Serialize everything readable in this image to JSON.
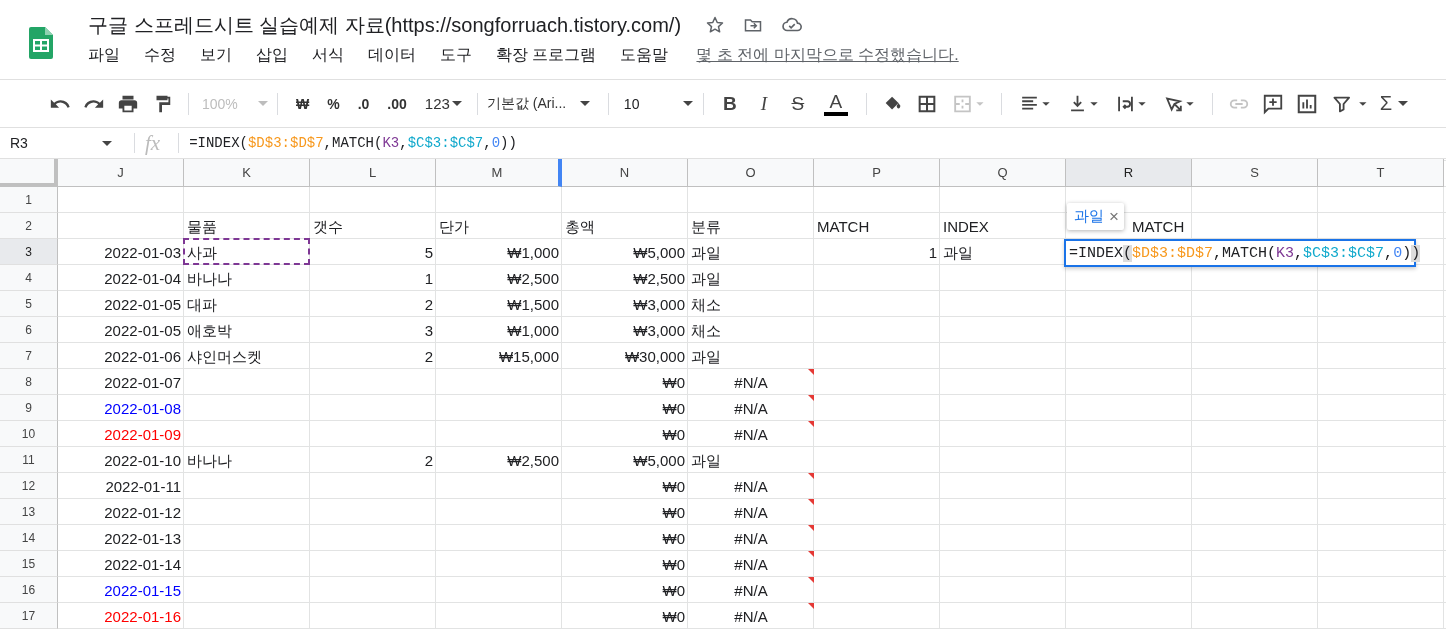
{
  "title": "구글 스프레드시트 실습예제 자료(https://songforruach.tistory.com/)",
  "menu": [
    "파일",
    "수정",
    "보기",
    "삽입",
    "서식",
    "데이터",
    "도구",
    "확장 프로그램",
    "도움말"
  ],
  "last_edit": "몇 초 전에 마지막으로 수정했습니다.",
  "toolbar": {
    "zoom": {
      "value": "100%",
      "disabled": true
    },
    "formats": [
      "₩",
      "%",
      ".0",
      ".00",
      "123"
    ],
    "font": "기본값 (Ari...",
    "font_size": "10",
    "styles": [
      "B",
      "I",
      "S",
      "A"
    ],
    "sum": "Σ"
  },
  "name_box": "R3",
  "function_label": "fx",
  "formula": [
    {
      "text": "=INDEX("
    },
    {
      "text": "$D$3:$D$7",
      "color": "#f7981d"
    },
    {
      "text": ",MATCH("
    },
    {
      "text": "K3",
      "color": "#7e3794"
    },
    {
      "text": ","
    },
    {
      "text": "$C$3:$C$7",
      "color": "#11a9cc"
    },
    {
      "text": ","
    },
    {
      "text": "0",
      "color": "#4285f4"
    },
    {
      "text": "))"
    }
  ],
  "columns": [
    {
      "letter": "J",
      "selected": false
    },
    {
      "letter": "K",
      "selected": false
    },
    {
      "letter": "L",
      "selected": false
    },
    {
      "letter": "M",
      "selected": false
    },
    {
      "letter": "N",
      "selected": false
    },
    {
      "letter": "O",
      "selected": false
    },
    {
      "letter": "P",
      "selected": false
    },
    {
      "letter": "Q",
      "selected": false
    },
    {
      "letter": "R",
      "selected": true
    },
    {
      "letter": "S",
      "selected": false
    },
    {
      "letter": "T",
      "selected": false
    }
  ],
  "rows": [
    {
      "number": "1",
      "selected": false,
      "cells": {}
    },
    {
      "number": "2",
      "selected": false,
      "cells": {
        "K": {
          "text": "물품",
          "kind": "text"
        },
        "L": {
          "text": "갯수",
          "kind": "text"
        },
        "M": {
          "text": "단가",
          "kind": "text"
        },
        "N": {
          "text": "총액",
          "kind": "text"
        },
        "O": {
          "text": "분류",
          "kind": "text"
        },
        "P": {
          "text": "MATCH",
          "kind": "text"
        },
        "Q": {
          "text": "INDEX",
          "kind": "text"
        },
        "R": {
          "text": "MATCH",
          "kind": "partial"
        }
      }
    },
    {
      "number": "3",
      "selected": true,
      "cells": {
        "J": {
          "text": "2022-01-03",
          "kind": "date"
        },
        "K": {
          "text": "사과",
          "kind": "text",
          "marquee": true
        },
        "L": {
          "text": "5",
          "kind": "number"
        },
        "M": {
          "text": "₩1,000",
          "kind": "number"
        },
        "N": {
          "text": "₩5,000",
          "kind": "number"
        },
        "O": {
          "text": "과일",
          "kind": "text"
        },
        "P": {
          "text": "1",
          "kind": "number"
        },
        "Q": {
          "text": "과일",
          "kind": "text"
        }
      }
    },
    {
      "number": "4",
      "selected": false,
      "cells": {
        "J": {
          "text": "2022-01-04",
          "kind": "date"
        },
        "K": {
          "text": "바나나",
          "kind": "text"
        },
        "L": {
          "text": "1",
          "kind": "number"
        },
        "M": {
          "text": "₩2,500",
          "kind": "number"
        },
        "N": {
          "text": "₩2,500",
          "kind": "number"
        },
        "O": {
          "text": "과일",
          "kind": "text"
        }
      }
    },
    {
      "number": "5",
      "selected": false,
      "cells": {
        "J": {
          "text": "2022-01-05",
          "kind": "date"
        },
        "K": {
          "text": "대파",
          "kind": "text"
        },
        "L": {
          "text": "2",
          "kind": "number"
        },
        "M": {
          "text": "₩1,500",
          "kind": "number"
        },
        "N": {
          "text": "₩3,000",
          "kind": "number"
        },
        "O": {
          "text": "채소",
          "kind": "text"
        }
      }
    },
    {
      "number": "6",
      "selected": false,
      "cells": {
        "J": {
          "text": "2022-01-05",
          "kind": "date"
        },
        "K": {
          "text": "애호박",
          "kind": "text"
        },
        "L": {
          "text": "3",
          "kind": "number"
        },
        "M": {
          "text": "₩1,000",
          "kind": "number"
        },
        "N": {
          "text": "₩3,000",
          "kind": "number"
        },
        "O": {
          "text": "채소",
          "kind": "text"
        }
      }
    },
    {
      "number": "7",
      "selected": false,
      "cells": {
        "J": {
          "text": "2022-01-06",
          "kind": "date"
        },
        "K": {
          "text": "샤인머스켓",
          "kind": "text"
        },
        "L": {
          "text": "2",
          "kind": "number"
        },
        "M": {
          "text": "₩15,000",
          "kind": "number"
        },
        "N": {
          "text": "₩30,000",
          "kind": "number"
        },
        "O": {
          "text": "과일",
          "kind": "text"
        }
      }
    },
    {
      "number": "8",
      "selected": false,
      "cells": {
        "J": {
          "text": "2022-01-07",
          "kind": "date"
        },
        "N": {
          "text": "₩0",
          "kind": "number"
        },
        "O": {
          "text": "#N/A",
          "kind": "error"
        }
      }
    },
    {
      "number": "9",
      "selected": false,
      "cells": {
        "J": {
          "text": "2022-01-08",
          "kind": "date",
          "color": "#0000ff"
        },
        "N": {
          "text": "₩0",
          "kind": "number"
        },
        "O": {
          "text": "#N/A",
          "kind": "error"
        }
      }
    },
    {
      "number": "10",
      "selected": false,
      "cells": {
        "J": {
          "text": "2022-01-09",
          "kind": "date",
          "color": "#ff0000"
        },
        "N": {
          "text": "₩0",
          "kind": "number"
        },
        "O": {
          "text": "#N/A",
          "kind": "error"
        }
      }
    },
    {
      "number": "11",
      "selected": false,
      "cells": {
        "J": {
          "text": "2022-01-10",
          "kind": "date"
        },
        "K": {
          "text": "바나나",
          "kind": "text"
        },
        "L": {
          "text": "2",
          "kind": "number"
        },
        "M": {
          "text": "₩2,500",
          "kind": "number"
        },
        "N": {
          "text": "₩5,000",
          "kind": "number"
        },
        "O": {
          "text": "과일",
          "kind": "text"
        }
      }
    },
    {
      "number": "12",
      "selected": false,
      "cells": {
        "J": {
          "text": "2022-01-11",
          "kind": "date"
        },
        "N": {
          "text": "₩0",
          "kind": "number"
        },
        "O": {
          "text": "#N/A",
          "kind": "error"
        }
      }
    },
    {
      "number": "13",
      "selected": false,
      "cells": {
        "J": {
          "text": "2022-01-12",
          "kind": "date"
        },
        "N": {
          "text": "₩0",
          "kind": "number"
        },
        "O": {
          "text": "#N/A",
          "kind": "error"
        }
      }
    },
    {
      "number": "14",
      "selected": false,
      "cells": {
        "J": {
          "text": "2022-01-13",
          "kind": "date"
        },
        "N": {
          "text": "₩0",
          "kind": "number"
        },
        "O": {
          "text": "#N/A",
          "kind": "error"
        }
      }
    },
    {
      "number": "15",
      "selected": false,
      "cells": {
        "J": {
          "text": "2022-01-14",
          "kind": "date"
        },
        "N": {
          "text": "₩0",
          "kind": "number"
        },
        "O": {
          "text": "#N/A",
          "kind": "error"
        }
      }
    },
    {
      "number": "16",
      "selected": false,
      "cells": {
        "J": {
          "text": "2022-01-15",
          "kind": "date",
          "color": "#0000ff"
        },
        "N": {
          "text": "₩0",
          "kind": "number"
        },
        "O": {
          "text": "#N/A",
          "kind": "error"
        }
      }
    },
    {
      "number": "17",
      "selected": false,
      "cells": {
        "J": {
          "text": "2022-01-16",
          "kind": "date",
          "color": "#ff0000"
        },
        "N": {
          "text": "₩0",
          "kind": "number"
        },
        "O": {
          "text": "#N/A",
          "kind": "error"
        }
      }
    }
  ],
  "editor": {
    "tooltip": "과일",
    "close": "×",
    "formula": [
      {
        "text": "=INDEX"
      },
      {
        "text": "(",
        "matched": true
      },
      {
        "text": "$D$3:$D$7",
        "color": "#f7981d"
      },
      {
        "text": ",MATCH("
      },
      {
        "text": "K3",
        "color": "#7e3794"
      },
      {
        "text": ","
      },
      {
        "text": "$C$3:$C$7",
        "color": "#11a9cc"
      },
      {
        "text": ","
      },
      {
        "text": "0",
        "color": "#4285f4"
      },
      {
        "text": ")"
      },
      {
        "text": ")",
        "matched": true
      }
    ]
  }
}
